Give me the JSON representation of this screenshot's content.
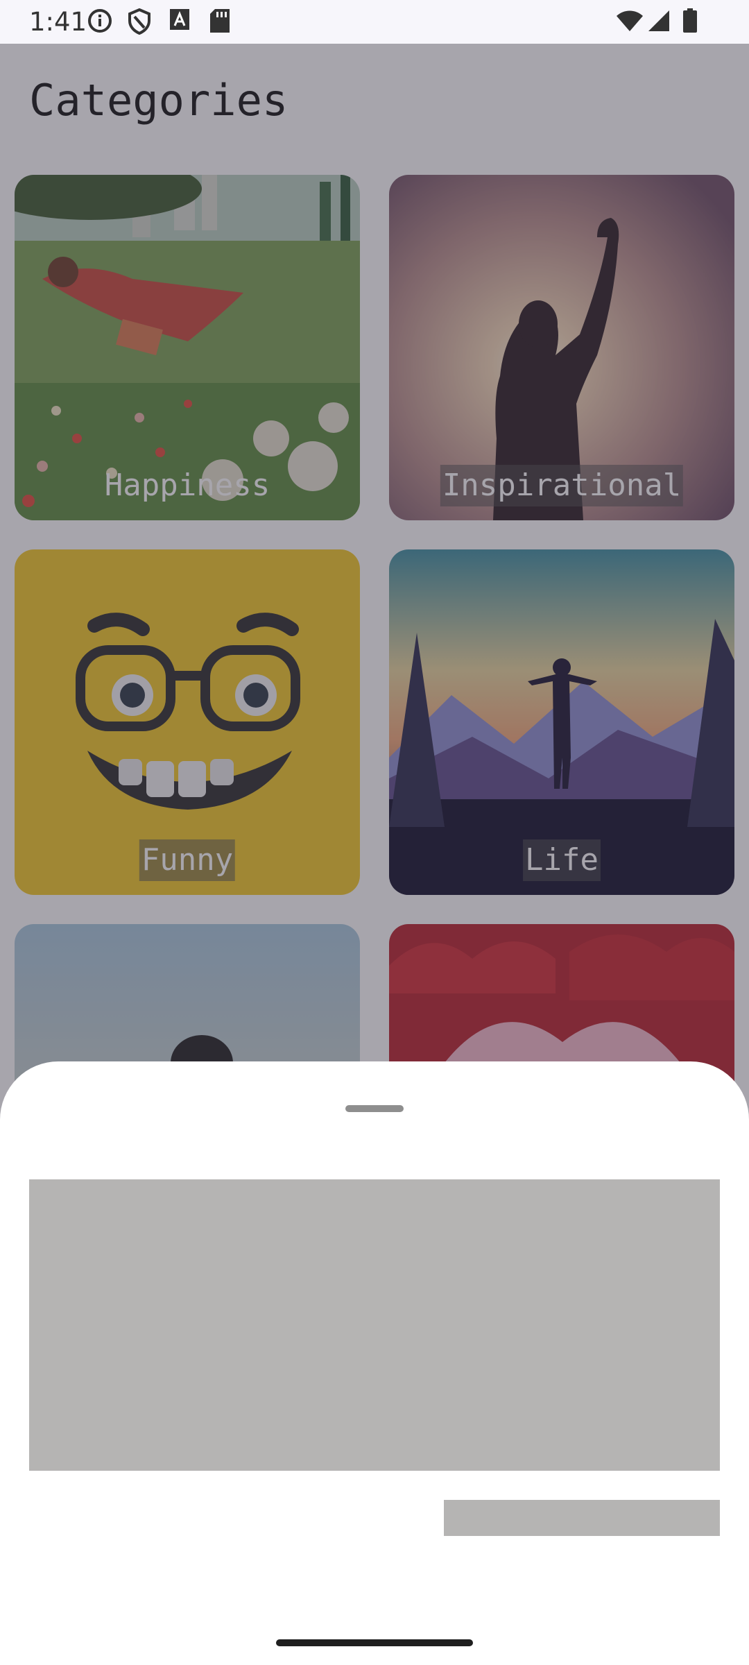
{
  "status_bar": {
    "time": "1:41",
    "left_icons": [
      "info-icon",
      "shield-icon",
      "text-a-icon",
      "sd-card-icon"
    ],
    "right_icons": [
      "wifi-icon",
      "signal-icon",
      "battery-icon"
    ]
  },
  "page": {
    "title": "Categories"
  },
  "categories": [
    {
      "label": "Happiness",
      "image": "woman-lying-in-meadow"
    },
    {
      "label": "Inspirational",
      "image": "silhouette-raised-fist"
    },
    {
      "label": "Funny",
      "image": "yellow-emoji-glasses"
    },
    {
      "label": "Life",
      "image": "man-arms-open-mountains"
    },
    {
      "label": "",
      "image": "sky-person"
    },
    {
      "label": "",
      "image": "red-hearts"
    }
  ],
  "colors": {
    "scrim": "#3c3746",
    "placeholder": "#b5b4b3",
    "sheet": "#ffffff"
  }
}
